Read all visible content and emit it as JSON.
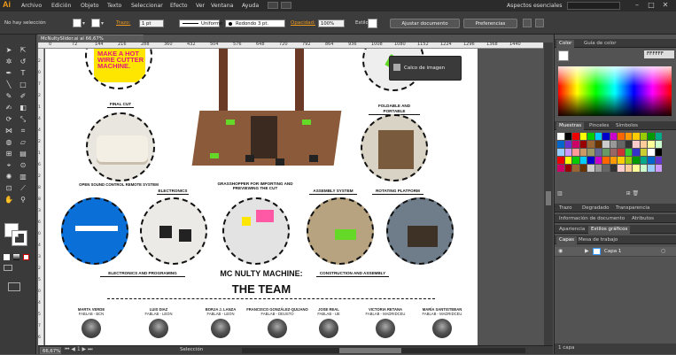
{
  "app": {
    "logo": "Ai",
    "workspace": "Aspectos esenciales",
    "window_controls": [
      "–",
      "□",
      "✕"
    ]
  },
  "menu": [
    "Archivo",
    "Edición",
    "Objeto",
    "Texto",
    "Seleccionar",
    "Efecto",
    "Ver",
    "Ventana",
    "Ayuda"
  ],
  "control_bar": {
    "selection_status": "No hay selección",
    "stroke_label": "Trazo:",
    "stroke_weight": "1 pt",
    "stroke_profile": "Uniforme",
    "brush": "Redondo 3 pt.",
    "opacity_label": "Opacidad:",
    "opacity_value": "100%",
    "style_label": "Estilo:",
    "doc_setup_button": "Ajustar documento",
    "preferences_button": "Preferencias"
  },
  "document": {
    "tab_title": "McNultySlider.ai al 66,67% (RGB/Previsualizar)",
    "zoom": "66,67%",
    "status_text": "Selección",
    "ruler_h": [
      "0",
      "72",
      "144",
      "216",
      "288",
      "360",
      "432",
      "504",
      "576",
      "648",
      "720",
      "792",
      "864",
      "936",
      "1008",
      "1080",
      "1152",
      "1224",
      "1296",
      "1368",
      "1440"
    ],
    "ruler_v": [
      "2",
      "0",
      "7",
      "2",
      "1",
      "4",
      "4",
      "2",
      "1",
      "6",
      "2",
      "8",
      "8",
      "3",
      "6",
      "0",
      "4",
      "3",
      "2",
      "5",
      "0",
      "4",
      "5",
      "7",
      "6"
    ]
  },
  "trace_popup": {
    "label": "Calco de imagen"
  },
  "artboard": {
    "poster_text": "MAKE A HOT WIRE CUTTER MACHINE.",
    "captions": {
      "final_cut": "FINAL CUT",
      "foldable": "FOLDABLE AND PORTABLE",
      "open_sound": "OPEN SOUND CONTROL REMOTE SYSTEM",
      "electronics": "ELECTRONICS",
      "grasshopper": "GRASSHOPPER FOR IMPORTING AND PREVIEWING THE CUT",
      "assembly": "ASSEMBLY SYSTEM",
      "rotating": "ROTATING PLATFORM",
      "electronics_programing": "ELECTRONICS AND PROGRAMING",
      "construction": "CONSTRUCTION AND ASSEMBLY"
    },
    "team_title_1": "MC NULTY MACHINE:",
    "team_title_2": "THE TEAM",
    "team": [
      {
        "name": "MARTA VERDE",
        "lab": "FABLAB - BCN"
      },
      {
        "name": "LUIS DIAZ",
        "lab": "FABLAB - LEON"
      },
      {
        "name": "BORJA J. LANZA",
        "lab": "FABLAB - LEON"
      },
      {
        "name": "FRANCISCO GONZÁLEZ-QUIJANO",
        "lab": "FABLAB - DEUSTO"
      },
      {
        "name": "JOSE REAL",
        "lab": "FABLAB - UE"
      },
      {
        "name": "VICTORIA RETANA",
        "lab": "FABLAB - MADRIDCEU"
      },
      {
        "name": "MARÍA SANTISTEBAN",
        "lab": "FABLAB - MADRIDCEU"
      }
    ]
  },
  "panels": {
    "color_tabs": [
      "Color",
      "Guía de color"
    ],
    "hex_value": "FFFFFF",
    "swatch_tabs": [
      "Muestras",
      "Pinceles",
      "Símbolos"
    ],
    "stroke_tabs": [
      "Trazo",
      "Degradado",
      "Transparencia"
    ],
    "info_tabs": [
      "Información de documento",
      "Atributos"
    ],
    "appearance_tabs": [
      "Apariencia",
      "Estilos gráficos"
    ],
    "layer_tabs": [
      "Capas",
      "Mesa de trabajo"
    ],
    "layer_name": "Capa 1",
    "layer_count": "1 capa"
  },
  "colors": {
    "accent": "#f29b1b",
    "pink": "#e3187d",
    "yellow": "#ffe600",
    "green": "#64d928"
  }
}
